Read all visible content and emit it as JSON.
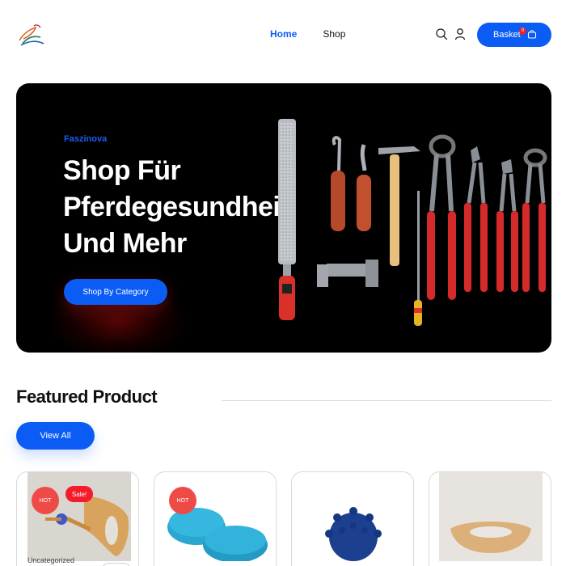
{
  "header": {
    "nav": [
      {
        "label": "Home",
        "active": true
      },
      {
        "label": "Shop",
        "active": false
      }
    ],
    "icons": [
      "search-icon",
      "user-icon",
      "basket-bag-icon"
    ],
    "basket": {
      "label": "Basket",
      "count": "0"
    }
  },
  "hero": {
    "kicker": "Faszinova",
    "title_line1": "Shop Für",
    "title_line2": "Pferdegesundheit",
    "title_line3": "Und Mehr",
    "cta_label": "Shop By Category"
  },
  "featured": {
    "title": "Featured Product",
    "view_all_label": "View All",
    "products": [
      {
        "hot": "HOT",
        "sale": "Sale!",
        "category": "Uncategorized"
      },
      {
        "hot": "HOT"
      },
      {},
      {}
    ]
  },
  "colors": {
    "accent": "#0b5cf5",
    "hot": "#ef4b46",
    "sale": "#f21c2b",
    "hero_bg": "#000000"
  }
}
